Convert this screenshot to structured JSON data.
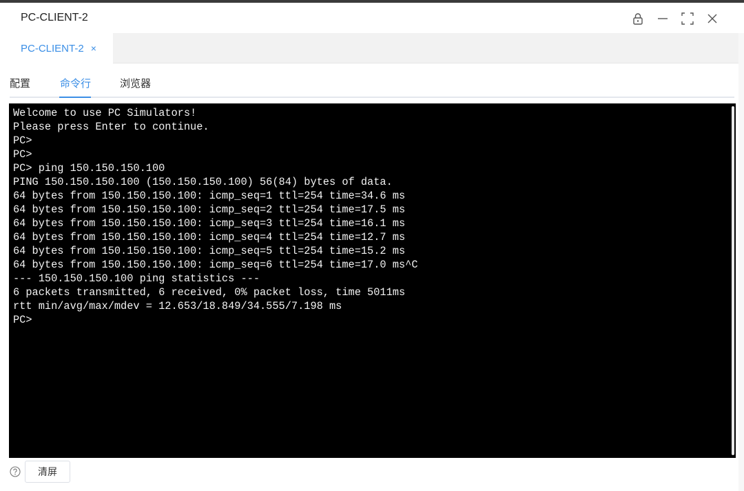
{
  "window": {
    "title": "PC-CLIENT-2"
  },
  "doc_tab": {
    "label": "PC-CLIENT-2",
    "close": "×"
  },
  "subtabs": [
    {
      "label": "配置",
      "active": false
    },
    {
      "label": "命令行",
      "active": true
    },
    {
      "label": "浏览器",
      "active": false
    }
  ],
  "terminal": {
    "lines": [
      "Welcome to use PC Simulators!",
      "Please press Enter to continue.",
      "PC>",
      "PC>",
      "PC> ping 150.150.150.100",
      "PING 150.150.150.100 (150.150.150.100) 56(84) bytes of data.",
      "64 bytes from 150.150.150.100: icmp_seq=1 ttl=254 time=34.6 ms",
      "64 bytes from 150.150.150.100: icmp_seq=2 ttl=254 time=17.5 ms",
      "64 bytes from 150.150.150.100: icmp_seq=3 ttl=254 time=16.1 ms",
      "64 bytes from 150.150.150.100: icmp_seq=4 ttl=254 time=12.7 ms",
      "64 bytes from 150.150.150.100: icmp_seq=5 ttl=254 time=15.2 ms",
      "64 bytes from 150.150.150.100: icmp_seq=6 ttl=254 time=17.0 ms^C",
      "--- 150.150.150.100 ping statistics ---",
      "6 packets transmitted, 6 received, 0% packet loss, time 5011ms",
      "rtt min/avg/max/mdev = 12.653/18.849/34.555/7.198 ms",
      "PC>"
    ]
  },
  "footer": {
    "clear_label": "清屏"
  },
  "icons": {
    "lock": "lock-icon",
    "minimize": "minimize-icon",
    "maximize": "maximize-icon",
    "close": "close-icon",
    "help": "help-icon"
  },
  "colors": {
    "accent": "#3a8ee6",
    "terminal_bg": "#000000",
    "terminal_fg": "#f2f2f2"
  }
}
